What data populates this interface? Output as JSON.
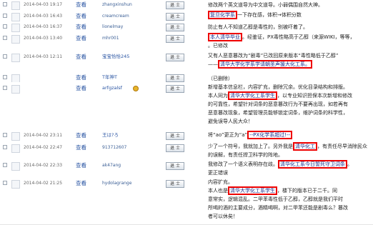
{
  "view_label": "查看",
  "rows": [
    {
      "date": "2014-04-03 19:17",
      "user": "zhangxinshun",
      "button": "退 士",
      "text_lines": [
        {
          "segments": [
            {
              "t": "修改两个英文道导为中文道导。小弱偶围自然大神。",
              "k": "normal"
            }
          ]
        }
      ]
    },
    {
      "date": "2014-04-03 16:43",
      "user": "creamcream",
      "button": "退 士",
      "text_lines": [
        {
          "segments": [
            {
              "t": "复旦化学系",
              "k": "hl"
            },
            {
              "t": "一下存在感，体积→体积分数",
              "k": "normal"
            }
          ]
        }
      ]
    },
    {
      "date": "2014-04-03 16:37",
      "user": "lionelmay",
      "button": "退 士",
      "text_lines": [
        {
          "segments": [
            {
              "t": "防止有人不知道乙醇是毒性的，别被吓着了。",
              "k": "normal"
            }
          ]
        }
      ]
    },
    {
      "date": "2014-04-03 13:40",
      "user": "mhr001",
      "button": "退 士",
      "text_lines": [
        {
          "segments": [
            {
              "t": "本人清华毕业",
              "k": "hl"
            },
            {
              "t": "。经鉴证，PX毒性略高于乙醇（来源WIKI，等等，",
              "k": "normal"
            }
          ]
        },
        {
          "segments": [
            {
              "t": "。已修改",
              "k": "normal"
            }
          ]
        }
      ]
    },
    {
      "date": "2014-04-03 12:11",
      "user": "宝宝恰恰245",
      "button": "退 士",
      "text_lines": [
        {
          "segments": [
            {
              "t": "又有人恶意篡改为“剧毒”已改回原来版本“毒性略低于乙醇”",
              "k": "normal"
            }
          ]
        },
        {
          "segments": [
            {
              "t": "——",
              "k": "normal"
            },
            {
              "t": "清华大学化学系学请朝圣声援大化工系。",
              "k": "hl"
            }
          ]
        }
      ]
    },
    {
      "date": "",
      "user": "T年神T",
      "button": "退 士",
      "text_lines": [
        {
          "segments": [
            {
              "t": "（已删除）",
              "k": "normal"
            }
          ]
        }
      ]
    },
    {
      "date": "",
      "user": "arfgzalsf",
      "button": "退 士",
      "medal": true,
      "text_lines": [
        {
          "segments": [
            {
              "t": "新增基本信息栏，内容扩充，删除冗余。优化目录结构和排版。",
              "k": "normal"
            }
          ]
        },
        {
          "segments": [
            {
              "t": "本人同为",
              "k": "normal"
            },
            {
              "t": "清华大学化工系学生",
              "k": "hl"
            },
            {
              "t": "，以专业知识担保本次新增和修改",
              "k": "normal"
            }
          ]
        },
        {
          "segments": [
            {
              "t": "的可靠性，希望针对词条的恶意篡改行为不要再出现，如若再有",
              "k": "normal"
            }
          ]
        },
        {
          "segments": [
            {
              "t": "恶意篡改现象，希望管理员能够锁定词条，维护词条的科学性，",
              "k": "normal"
            }
          ]
        },
        {
          "segments": [
            {
              "t": "避免误导人民大众！",
              "k": "normal"
            }
          ]
        }
      ]
    },
    {
      "date": "2014-04-02 23:11",
      "user": "王は?ろ",
      "button": "退 士",
      "text_lines": [
        {
          "segments": [
            {
              "t": "将“ao”更正为“a”",
              "k": "normal"
            },
            {
              "t": "--PX化学系超过!--",
              "k": "hl"
            }
          ]
        }
      ]
    },
    {
      "date": "2014-04-02 22:47",
      "user": "913712607",
      "button": "退 士",
      "text_lines": [
        {
          "segments": [
            {
              "t": "少了一个符号，我就加上了。另外我是",
              "k": "normal"
            },
            {
              "t": "清华化工",
              "k": "hl"
            },
            {
              "t": "，有责任尽早消除民众",
              "k": "normal"
            }
          ]
        },
        {
          "segments": [
            {
              "t": "的误解，有责任捍卫科学的阵地。",
              "k": "normal"
            }
          ]
        }
      ]
    },
    {
      "date": "2014-04-02 22:33",
      "user": "ak47ang",
      "button": "退 士",
      "text_lines": [
        {
          "segments": [
            {
              "t": "我修改了一个语义表明存在歧。",
              "k": "normal"
            },
            {
              "t": "清华化工系今日誓死守卫词条",
              "k": "hl"
            },
            {
              "t": "。",
              "k": "normal"
            }
          ]
        },
        {
          "segments": [
            {
              "t": "更正错误",
              "k": "normal"
            }
          ]
        }
      ]
    },
    {
      "date": "2014-04-02 21:25",
      "user": "hydolagrange",
      "button": "退 士",
      "text_lines": [
        {
          "segments": [
            {
              "t": "内容扩充。",
              "k": "normal"
            }
          ]
        },
        {
          "segments": [
            {
              "t": "本人也是",
              "k": "normal"
            },
            {
              "t": "清华大学化工系学生",
              "k": "hl"
            },
            {
              "t": "，楼下的版本已于二千。同",
              "k": "normal"
            }
          ]
        },
        {
          "segments": [
            {
              "t": "意常实，逻辑混乱。二甲苯毒性低于乙醇，乙醇就是我们平时",
              "k": "normal"
            }
          ]
        },
        {
          "segments": [
            {
              "t": "所喝的酒的主要成分，酒精喝啊，对二甲苯还能是剧毒么？篡改",
              "k": "normal"
            }
          ]
        },
        {
          "segments": [
            {
              "t": "者可以休矣！",
              "k": "normal"
            }
          ]
        }
      ]
    }
  ]
}
